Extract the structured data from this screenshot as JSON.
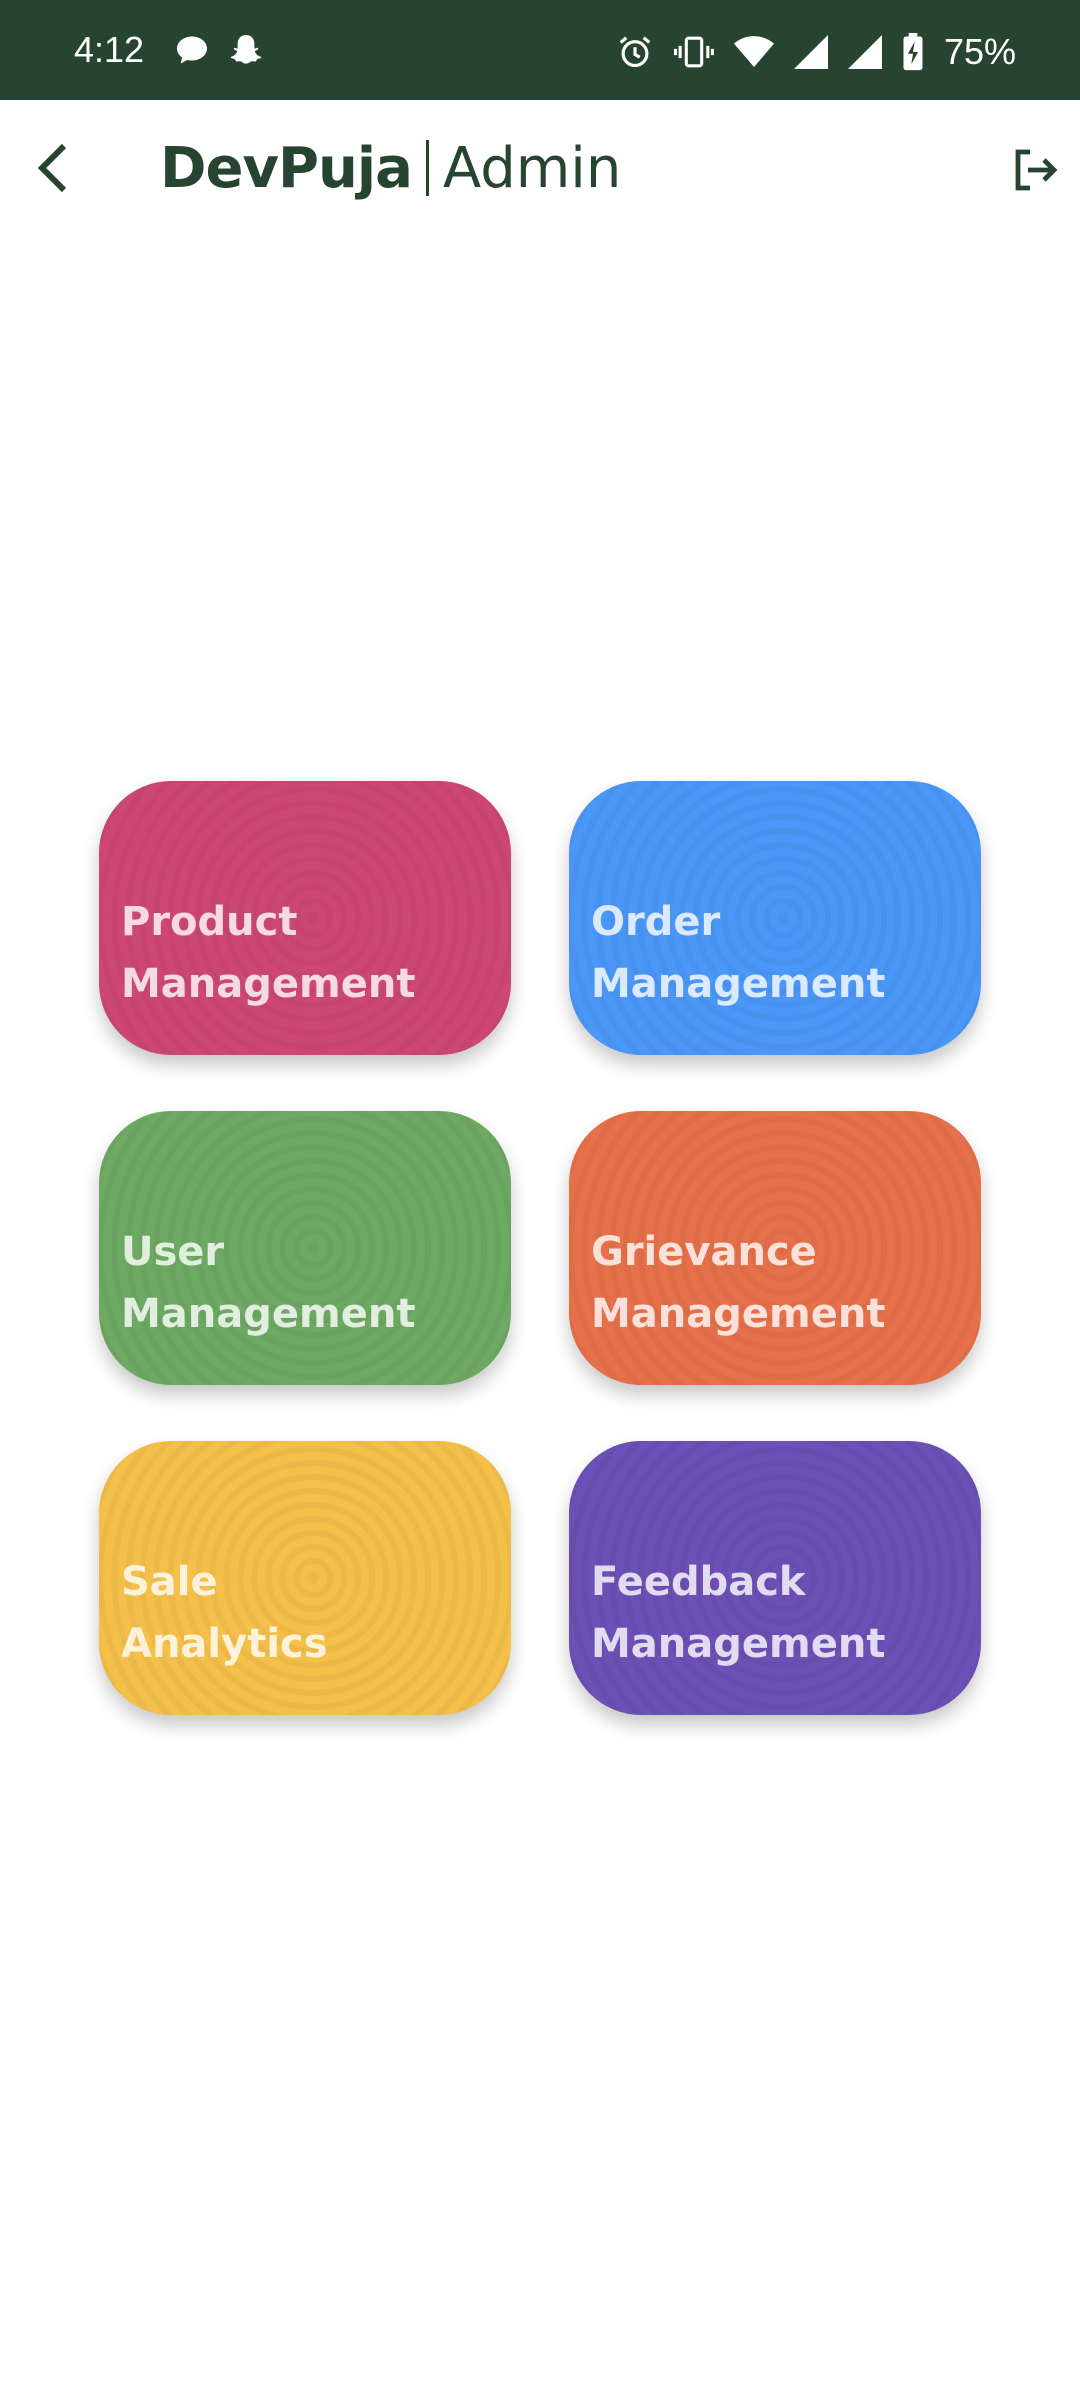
{
  "status_bar": {
    "time": "4:12",
    "battery": "75%",
    "icons": [
      "chat-bubble-icon",
      "snapchat-ghost-icon",
      "alarm-icon",
      "vibrate-icon",
      "wifi-icon",
      "signal-icon",
      "signal-icon",
      "battery-charging-icon"
    ]
  },
  "app_bar": {
    "brand_name": "DevPuja",
    "role": "Admin",
    "back_icon": "chevron-left-icon",
    "logout_icon": "logout-icon"
  },
  "colors": {
    "status_bar": "#274430",
    "brand": "#274430",
    "product": "#CD4775",
    "order": "#4A97F7",
    "user": "#6EA963",
    "grievance": "#E6704A",
    "sale": "#F5C04A",
    "feedback": "#6C50B5"
  },
  "tiles": [
    {
      "label": "Product\nManagement",
      "color": "#CD4775"
    },
    {
      "label": "Order\nManagement",
      "color": "#4A97F7"
    },
    {
      "label": "User\n Management",
      "color": "#6EA963"
    },
    {
      "label": "Grievance\n Management",
      "color": "#E6704A"
    },
    {
      "label": "Sale\n Analytics",
      "color": "#F5C04A"
    },
    {
      "label": "Feedback\n Management",
      "color": "#6C50B5"
    }
  ]
}
